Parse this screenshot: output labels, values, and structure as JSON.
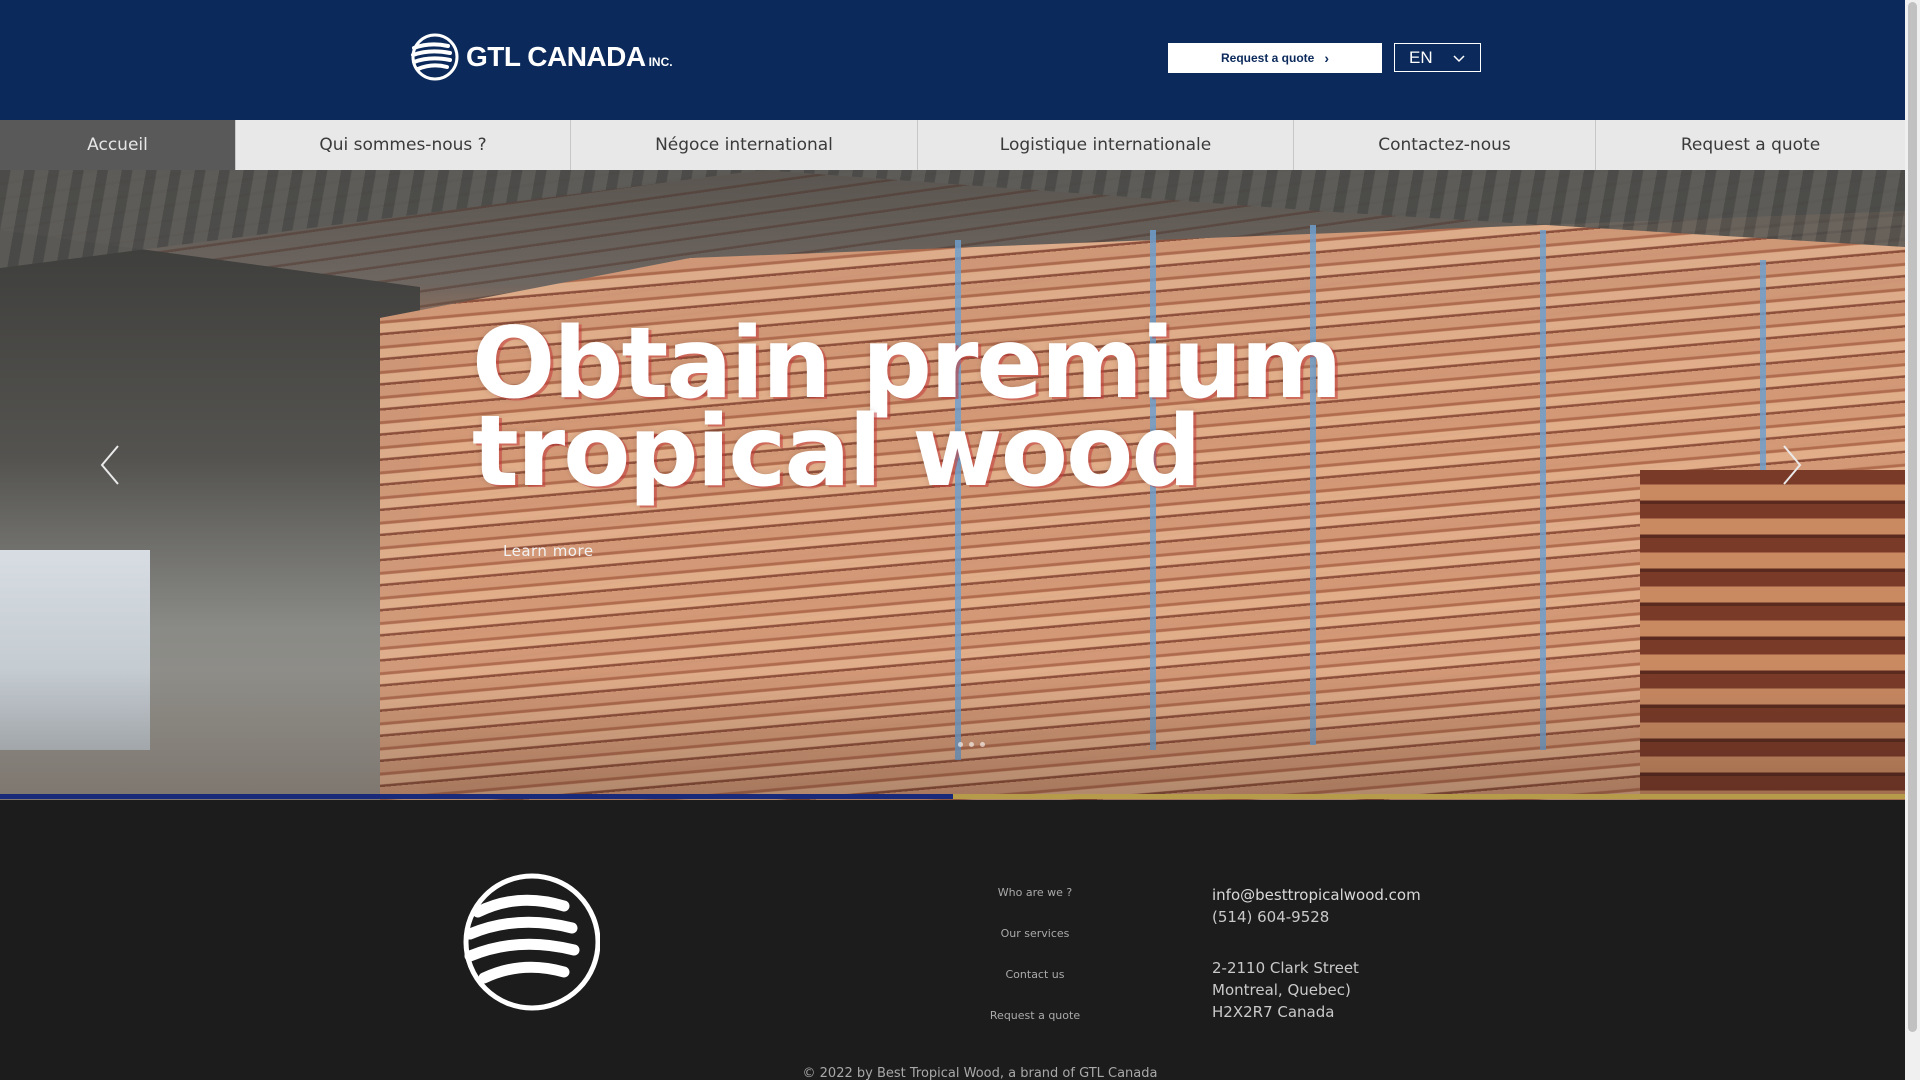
{
  "header": {
    "logo_text": "GTL CANADA",
    "logo_suffix": "INC.",
    "quote_button": "Request a quote",
    "language": "EN"
  },
  "nav": {
    "items": [
      {
        "label": "Accueil"
      },
      {
        "label": "Qui sommes-nous ?"
      },
      {
        "label": "Négoce international"
      },
      {
        "label": "Logistique internationale"
      },
      {
        "label": "Contactez-nous"
      },
      {
        "label": "Request a quote"
      }
    ]
  },
  "hero": {
    "title_line1": "Obtain premium",
    "title_line2": "tropical wood",
    "link": "Learn more",
    "slide_progress": 0.5
  },
  "footer": {
    "links": [
      "Who are we ?",
      "Our services",
      "Contact us",
      "Request a quote"
    ],
    "email": "info@besttropicalwood.com",
    "phone": "(514) 604-9528",
    "address_line1": "2-2110 Clark Street",
    "address_line2": "Montreal, Quebec)",
    "address_line3": "H2X2R7 Canada",
    "copyright": "© 2022 by Best Tropical Wood, a brand of GTL Canada"
  },
  "colors": {
    "header_bg": "#0b2a5b",
    "nav_bg": "#e8e8e8",
    "nav_active_bg": "#595959",
    "footer_bg": "#1c1c1c",
    "progress_track": "#b59b4a",
    "progress_fill": "#1a2a7a"
  },
  "icons": {
    "logo": "globe-logo-icon",
    "quote_arrow": "chevron-right-icon",
    "lang_arrow": "chevron-down-icon",
    "prev": "chevron-left-icon",
    "next": "chevron-right-icon"
  }
}
